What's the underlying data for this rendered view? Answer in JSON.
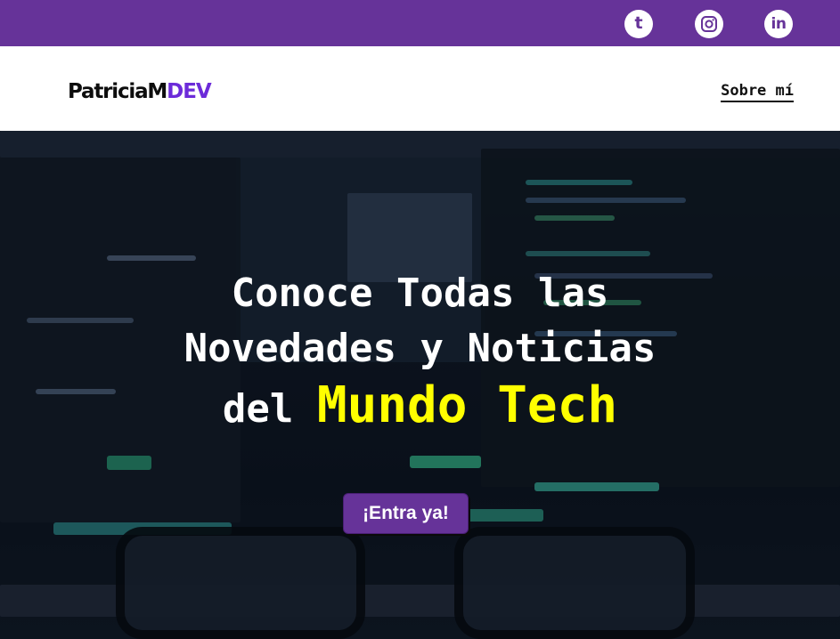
{
  "social": {
    "tumblr": {
      "icon": "tumblr-icon",
      "glyph": "t"
    },
    "instagram": {
      "icon": "instagram-icon"
    },
    "linkedin": {
      "icon": "linkedin-icon",
      "glyph": "in"
    }
  },
  "header": {
    "logo_main": "PatriciaM",
    "logo_accent": "DEV",
    "nav_about": "Sobre mí"
  },
  "hero": {
    "title_line1": "Conoce Todas las",
    "title_line2": "Novedades y Noticias",
    "title_line3_prefix": "del",
    "title_highlight": "Mundo Tech",
    "cta_label": "¡Entra ya!"
  },
  "colors": {
    "brand_purple": "#663399",
    "logo_accent": "#6c2bd9",
    "highlight_yellow": "#ffff00"
  }
}
